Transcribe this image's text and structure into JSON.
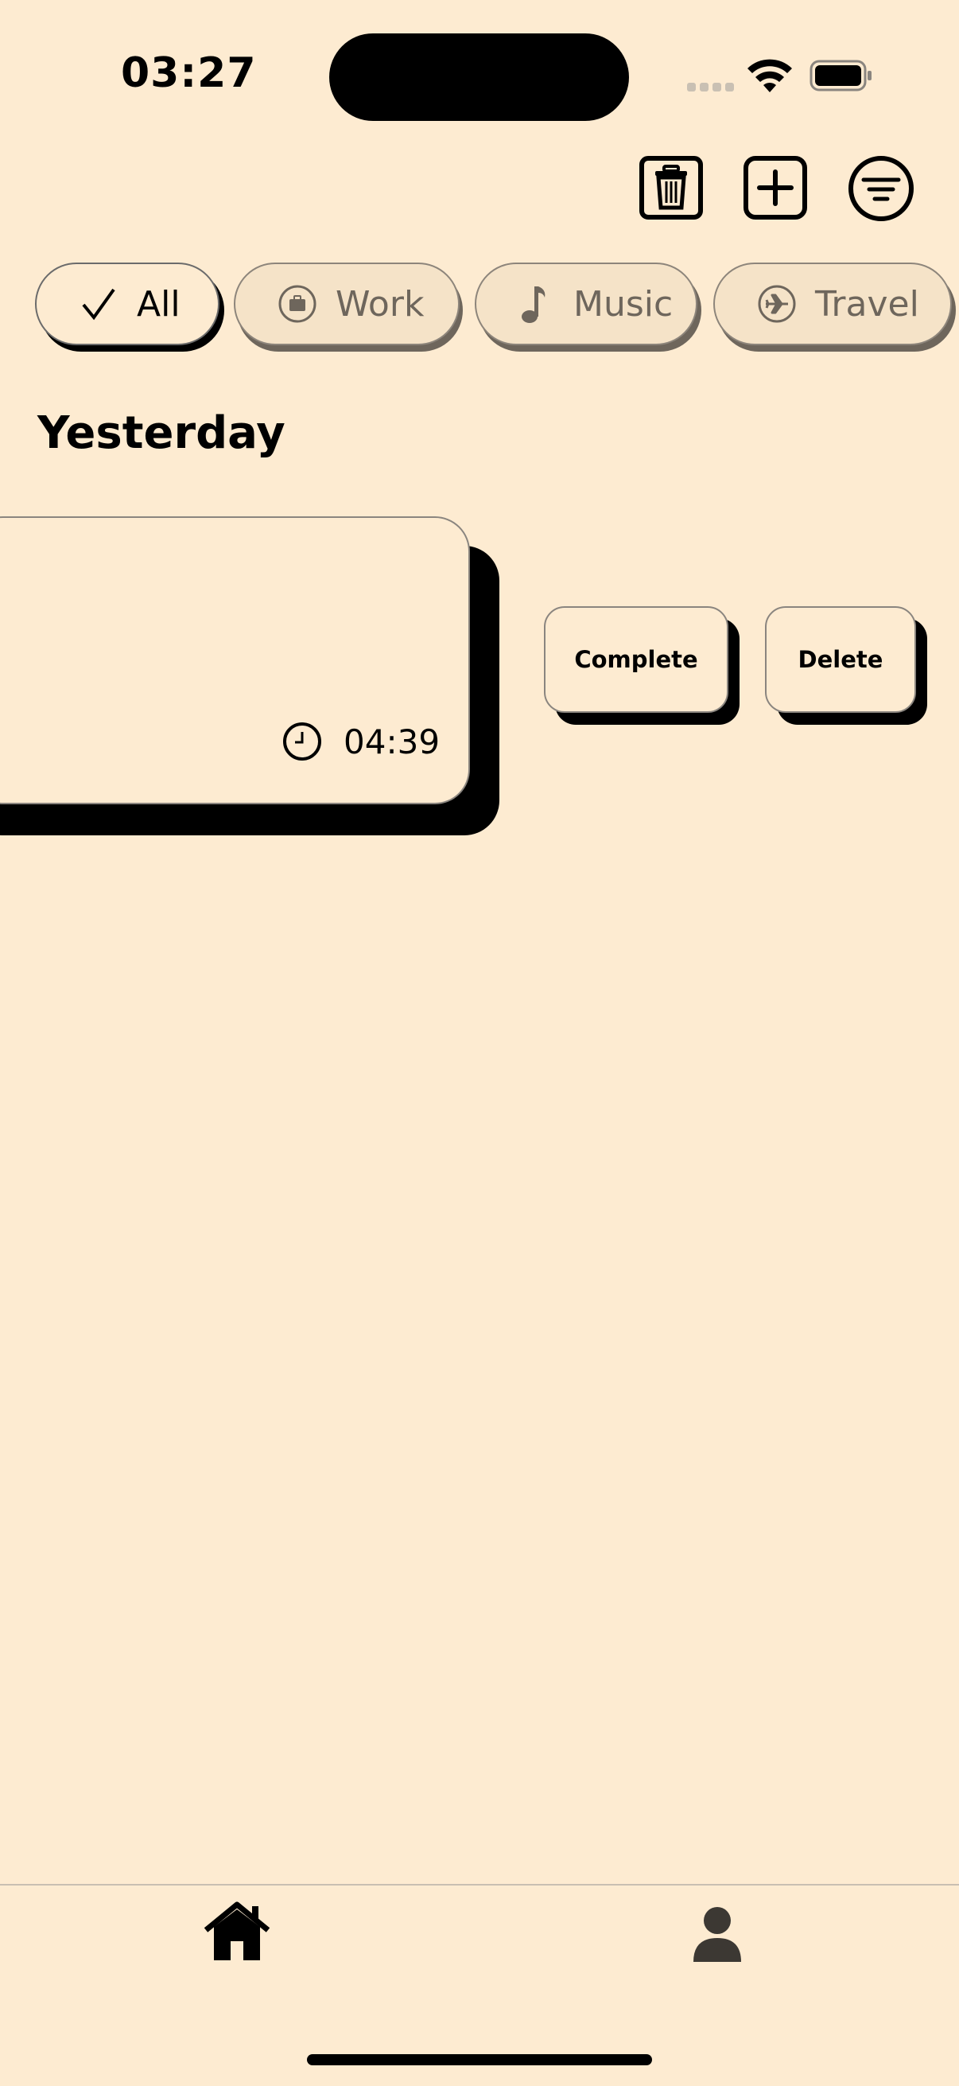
{
  "status_bar": {
    "time": "03:27"
  },
  "toolbar": {
    "delete_icon": "trash-icon",
    "add_icon": "plus-square-icon",
    "filter_icon": "filter-icon"
  },
  "categories": [
    {
      "label": "All",
      "icon": "checkmark-icon",
      "selected": true
    },
    {
      "label": "Work",
      "icon": "briefcase-icon",
      "selected": false
    },
    {
      "label": "Music",
      "icon": "music-note-icon",
      "selected": false
    },
    {
      "label": "Travel",
      "icon": "airplane-icon",
      "selected": false
    }
  ],
  "section": {
    "title": "Yesterday"
  },
  "task_card": {
    "time": "04:39",
    "actions": {
      "complete_label": "Complete",
      "delete_label": "Delete"
    }
  },
  "tabbar": {
    "items": [
      {
        "icon": "home-icon",
        "selected": true
      },
      {
        "icon": "profile-icon",
        "selected": false
      }
    ]
  },
  "colors": {
    "background": "#fdebd1",
    "chip_inactive": "#f5e3c8",
    "ink": "#000000",
    "muted": "#6e665c"
  }
}
